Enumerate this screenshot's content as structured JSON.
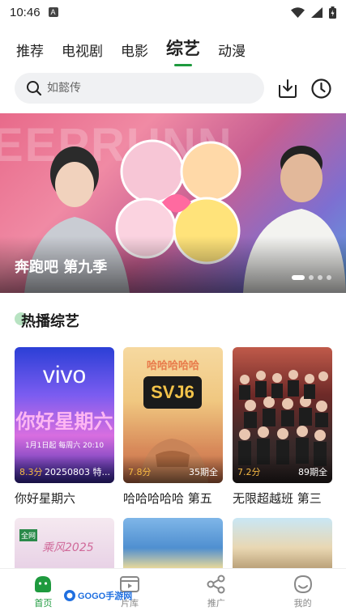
{
  "status": {
    "time": "10:46",
    "notif_letter": "A"
  },
  "tabs": [
    {
      "label": "推荐"
    },
    {
      "label": "电视剧"
    },
    {
      "label": "电影"
    },
    {
      "label": "综艺",
      "active": true
    },
    {
      "label": "动漫"
    }
  ],
  "search": {
    "placeholder": "如懿传"
  },
  "header_icons": [
    "download-icon",
    "history-icon"
  ],
  "banner": {
    "title": "奔跑吧 第九季",
    "bg_text": "EEPRUNN",
    "slides": 4,
    "active_slide": 0
  },
  "section": {
    "title": "热播综艺"
  },
  "cards": [
    {
      "title": "你好星期六",
      "rating": "8.3分",
      "info": "20250803 特...",
      "poster_text": "vivo",
      "poster_sub": "你好星期六",
      "poster_date": "1月1日起 每周六 20:10"
    },
    {
      "title": "哈哈哈哈哈 第五",
      "rating": "7.8分",
      "info": "35期全",
      "poster_text": "SVJ6",
      "poster_sub": "哈哈哈哈哈"
    },
    {
      "title": "无限超越班 第三",
      "rating": "7.2分",
      "info": "89期全"
    }
  ],
  "row2": [
    {
      "text": "乘风2025",
      "badge": "全网"
    },
    {
      "text": ""
    },
    {
      "text": ""
    }
  ],
  "watermark": {
    "text": "GOGO手游网"
  },
  "nav": [
    {
      "label": "首页",
      "icon": "home-icon",
      "active": true
    },
    {
      "label": "片库",
      "icon": "video-library-icon"
    },
    {
      "label": "推广",
      "icon": "share-icon"
    },
    {
      "label": "我的",
      "icon": "profile-icon"
    }
  ],
  "colors": {
    "accent": "#1e9a3e",
    "rating": "#f5b942"
  }
}
